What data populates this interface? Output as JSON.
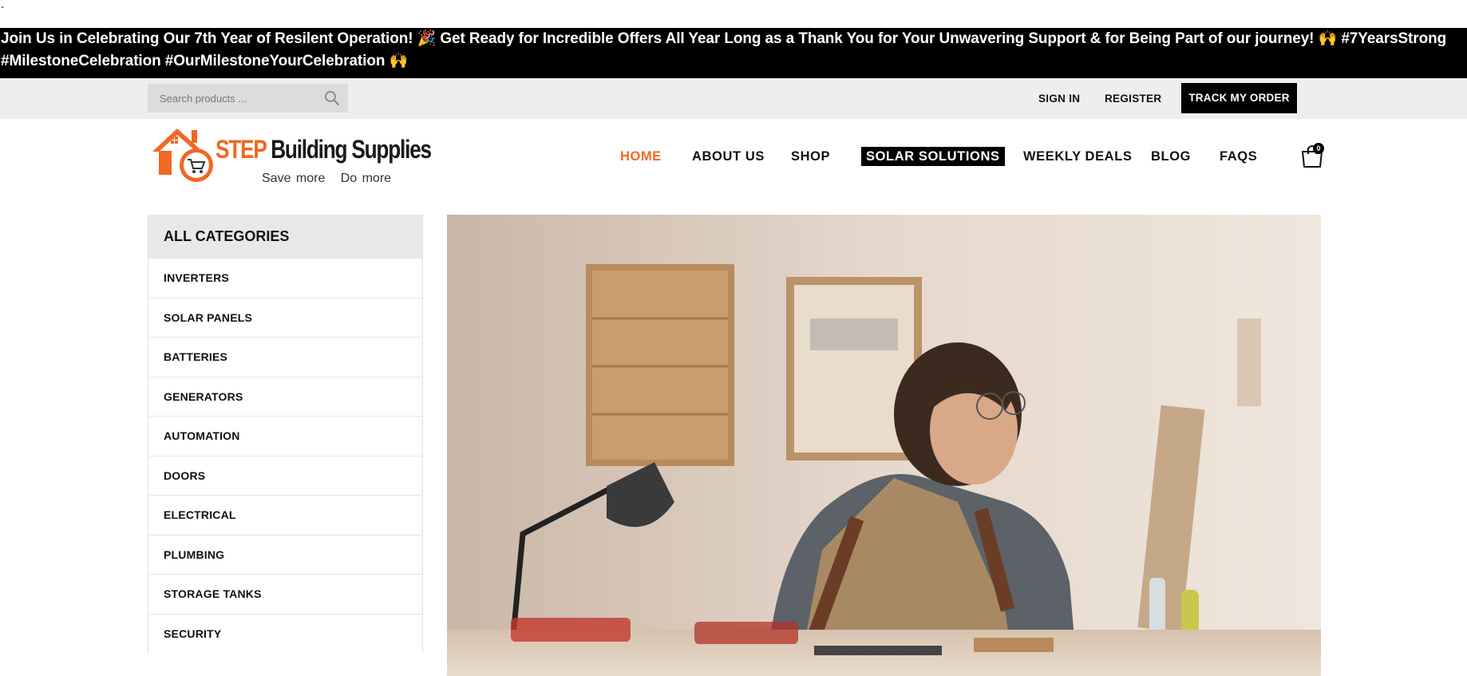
{
  "stray_mark": "-",
  "announcement": {
    "text_a": "Join Us in Celebrating Our 7th Year of Resilent Operation! ",
    "emoji_a": "🎉",
    "text_b": " Get Ready for Incredible Offers All Year Long as a Thank You for Your Unwavering Support & for Being Part of our journey! ",
    "emoji_b": "🙌",
    "text_c": " #7YearsStrong #MilestoneCelebration #OurMilestoneYourCelebration ",
    "emoji_c": "🙌"
  },
  "topbar": {
    "search_placeholder": "Search products ...",
    "search_icon": "search-icon",
    "sign_in": "SIGN IN",
    "register": "REGISTER",
    "track_order": "TRACK MY ORDER"
  },
  "logo": {
    "brand_step": "STEP",
    "brand_rest": "Building Supplies",
    "tagline": "Save more   Do more",
    "accent_color": "#f26722"
  },
  "nav": {
    "home": "HOME",
    "about": "ABOUT US",
    "shop": "SHOP",
    "solar": "SOLAR SOLUTIONS",
    "deals": "WEEKLY DEALS",
    "blog": "BLOG",
    "faqs": "FAQS",
    "cart_icon": "shopping-bag-icon",
    "cart_count": "0"
  },
  "categories": {
    "title": "ALL CATEGORIES",
    "items": [
      "INVERTERS",
      "SOLAR PANELS",
      "BATTERIES",
      "GENERATORS",
      "AUTOMATION",
      "DOORS",
      "ELECTRICAL",
      "PLUMBING",
      "STORAGE TANKS",
      "SECURITY"
    ]
  },
  "colors": {
    "accent": "#f26722",
    "announcement_bg": "#000000",
    "topbar_bg": "#eeeeee"
  }
}
